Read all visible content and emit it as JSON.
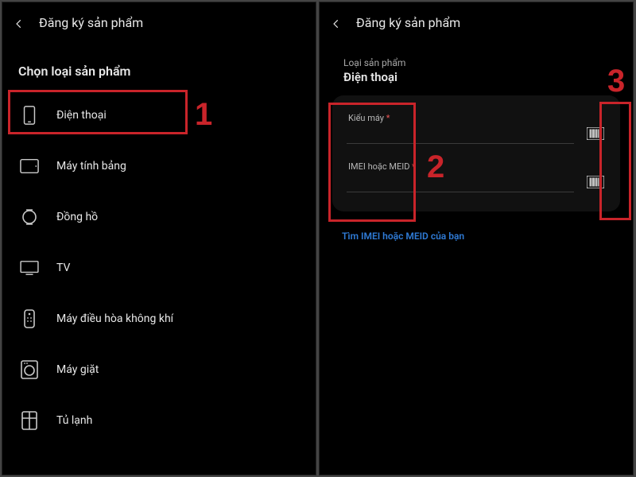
{
  "left": {
    "header_title": "Đăng ký sản phẩm",
    "section_title": "Chọn loại sản phẩm",
    "categories": [
      {
        "icon": "phone",
        "label": "Điện thoại"
      },
      {
        "icon": "tablet",
        "label": "Máy tính bảng"
      },
      {
        "icon": "watch",
        "label": "Đồng hồ"
      },
      {
        "icon": "tv",
        "label": "TV"
      },
      {
        "icon": "ac",
        "label": "Máy điều hòa không khí"
      },
      {
        "icon": "washer",
        "label": "Máy giặt"
      },
      {
        "icon": "fridge",
        "label": "Tủ lạnh"
      }
    ]
  },
  "right": {
    "header_title": "Đăng ký sản phẩm",
    "product_type_label": "Loại sản phẩm",
    "product_type_value": "Điện thoại",
    "model_label": "Kiểu máy",
    "imei_label": "IMEI hoặc MEID",
    "required_mark": "*",
    "find_link": "Tìm IMEI hoặc MEID của bạn"
  },
  "annotations": {
    "n1": "1",
    "n2": "2",
    "n3": "3"
  },
  "colors": {
    "annotation": "#c9242a",
    "link": "#2f7bd6",
    "required": "#e15353"
  }
}
